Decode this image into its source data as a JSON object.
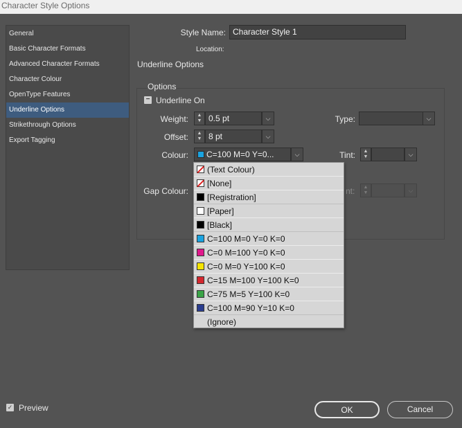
{
  "window": {
    "title": "Character Style Options"
  },
  "sidebar": {
    "items": [
      {
        "label": "General"
      },
      {
        "label": "Basic Character Formats"
      },
      {
        "label": "Advanced Character Formats"
      },
      {
        "label": "Character Colour"
      },
      {
        "label": "OpenType Features"
      },
      {
        "label": "Underline Options",
        "active": true
      },
      {
        "label": "Strikethrough Options"
      },
      {
        "label": "Export Tagging"
      }
    ]
  },
  "form": {
    "style_name_label": "Style Name:",
    "style_name_value": "Character Style 1",
    "location_label": "Location:",
    "section_title": "Underline Options",
    "options_title": "Options",
    "underline_on_label": "Underline On",
    "weight_label": "Weight:",
    "weight_value": "0.5 pt",
    "offset_label": "Offset:",
    "offset_value": "8 pt",
    "type_label": "Type:",
    "colour_label": "Colour:",
    "colour_value": "C=100 M=0 Y=0...",
    "tint_label": "Tint:",
    "gap_colour_label": "Gap Colour:",
    "gap_tint_partial": "nt:"
  },
  "colors": {
    "accent_selected": "#3e5c7f",
    "cyan": "#1aa3e0",
    "magenta": "#e0188c",
    "yellow": "#f5e400",
    "red": "#d4272e",
    "green": "#3aa447",
    "blue": "#2a3d8f"
  },
  "dropdown": {
    "items": [
      {
        "label": "(Text Colour)",
        "swatch": "none-icon"
      },
      {
        "label": "[None]",
        "swatch": "none-icon"
      },
      {
        "label": "[Registration]",
        "swatch": "#000000"
      },
      {
        "label": "[Paper]",
        "swatch": "#ffffff"
      },
      {
        "label": "[Black]",
        "swatch": "#000000"
      },
      {
        "label": "C=100 M=0 Y=0 K=0",
        "swatch": "#1aa3e0"
      },
      {
        "label": "C=0 M=100 Y=0 K=0",
        "swatch": "#e0188c"
      },
      {
        "label": "C=0 M=0 Y=100 K=0",
        "swatch": "#f5e400"
      },
      {
        "label": "C=15 M=100 Y=100 K=0",
        "swatch": "#d4272e"
      },
      {
        "label": "C=75 M=5 Y=100 K=0",
        "swatch": "#3aa447"
      },
      {
        "label": "C=100 M=90 Y=10 K=0",
        "swatch": "#2a3d8f"
      },
      {
        "label": "(Ignore)",
        "swatch": "blank"
      }
    ]
  },
  "footer": {
    "preview_label": "Preview",
    "ok_label": "OK",
    "cancel_label": "Cancel"
  }
}
